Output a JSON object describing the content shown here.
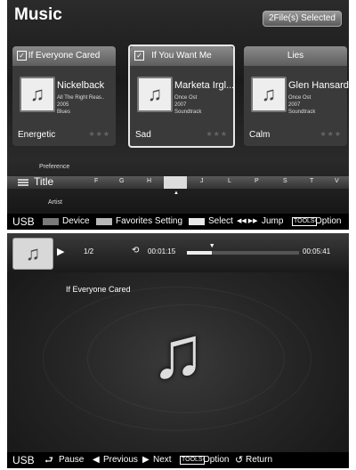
{
  "browser": {
    "title": "Music",
    "selected_badge": "2File(s) Selected",
    "cards": [
      {
        "header": "If Everyone Cared",
        "checked": true,
        "artist": "Nickelback",
        "album": "All The Right Reas..",
        "year": "2005",
        "genre": "Blues",
        "mood": "Energetic"
      },
      {
        "header": "If You Want Me",
        "checked": true,
        "artist": "Marketa Irgl...",
        "album": "Once Ost",
        "year": "2007",
        "genre": "Soundtrack",
        "mood": "Sad"
      },
      {
        "header": "Lies",
        "checked": false,
        "artist": "Glen Hansard",
        "album": "Once Ost",
        "year": "2007",
        "genre": "Soundtrack",
        "mood": "Calm"
      }
    ],
    "stars": "★★★",
    "checkmark": "✓",
    "music_glyph": "♫",
    "sort": {
      "prev": "Preference",
      "current": "Title",
      "next": "Artist"
    },
    "letters": [
      "F",
      "G",
      "H",
      "",
      "J",
      "L",
      "P",
      "S",
      "T",
      "V"
    ],
    "marker": "▲",
    "footer": {
      "source": "USB",
      "device": "Device",
      "favorites": "Favorites Setting",
      "select": "Select",
      "jump_icon": "◀◀ ▶▶",
      "jump": "Jump",
      "tools": "TOOLS",
      "option": "Option"
    }
  },
  "player": {
    "play_icon": "▶",
    "track": "1/2",
    "repeat_icon": "⟲",
    "current_time": "00:01:15",
    "total_time": "00:05:41",
    "progress": 0.22,
    "song_title": "If Everyone Cared",
    "note_glyph": "♫",
    "footer": {
      "source": "USB",
      "pause_icon": "⮐",
      "pause": "Pause",
      "previous_icon": "◀",
      "previous": "Previous",
      "next_icon": "▶",
      "next": "Next",
      "tools": "TOOLS",
      "option": "Option",
      "return_icon": "↺",
      "return": "Return"
    }
  },
  "colors": {
    "red_btn": "#c04040",
    "green_btn": "#4a9a4a",
    "yellow_btn": "#d8c84a",
    "blue_btn": "#4060c0",
    "device_swatch": "#7a7a7a",
    "favorites_swatch": "#b8b8b8",
    "select_swatch": "#e8e8e8"
  }
}
